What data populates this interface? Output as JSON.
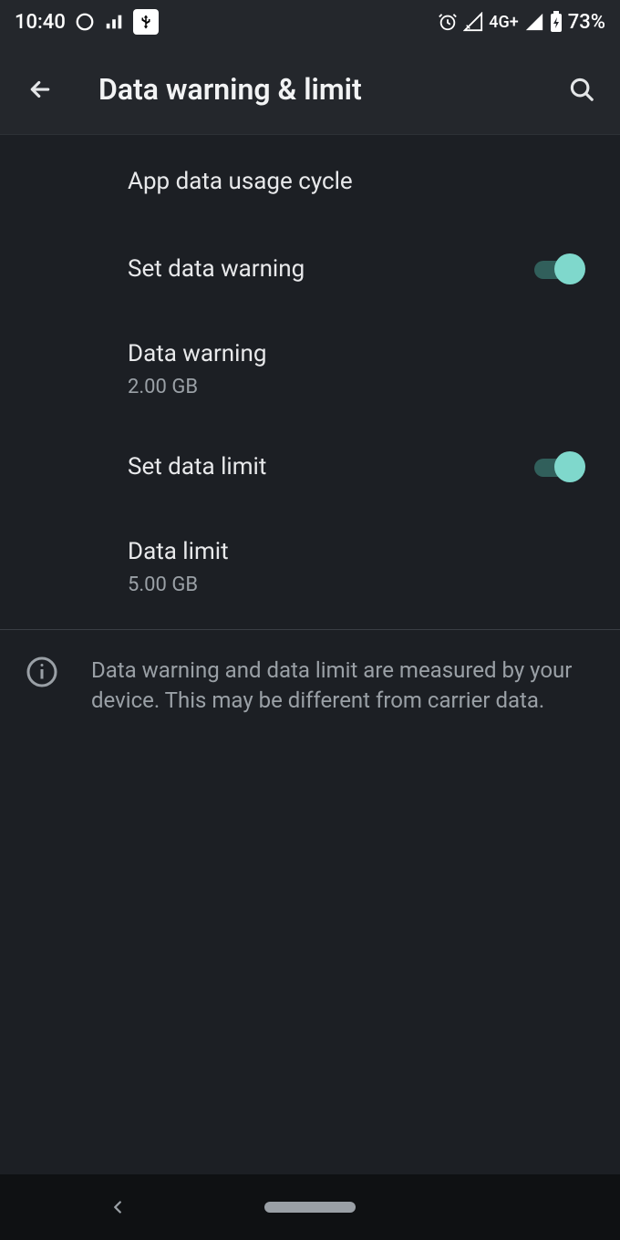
{
  "status": {
    "time": "10:40",
    "network_label": "4G+",
    "battery": "73%"
  },
  "header": {
    "title": "Data warning & limit"
  },
  "settings": {
    "usage_cycle": {
      "label": "App data usage cycle"
    },
    "set_warning": {
      "label": "Set data warning",
      "enabled": true
    },
    "warning": {
      "label": "Data warning",
      "value": "2.00 GB"
    },
    "set_limit": {
      "label": "Set data limit",
      "enabled": true
    },
    "limit": {
      "label": "Data limit",
      "value": "5.00 GB"
    }
  },
  "footer": {
    "note": "Data warning and data limit are measured by your device. This may be different from carrier data."
  }
}
